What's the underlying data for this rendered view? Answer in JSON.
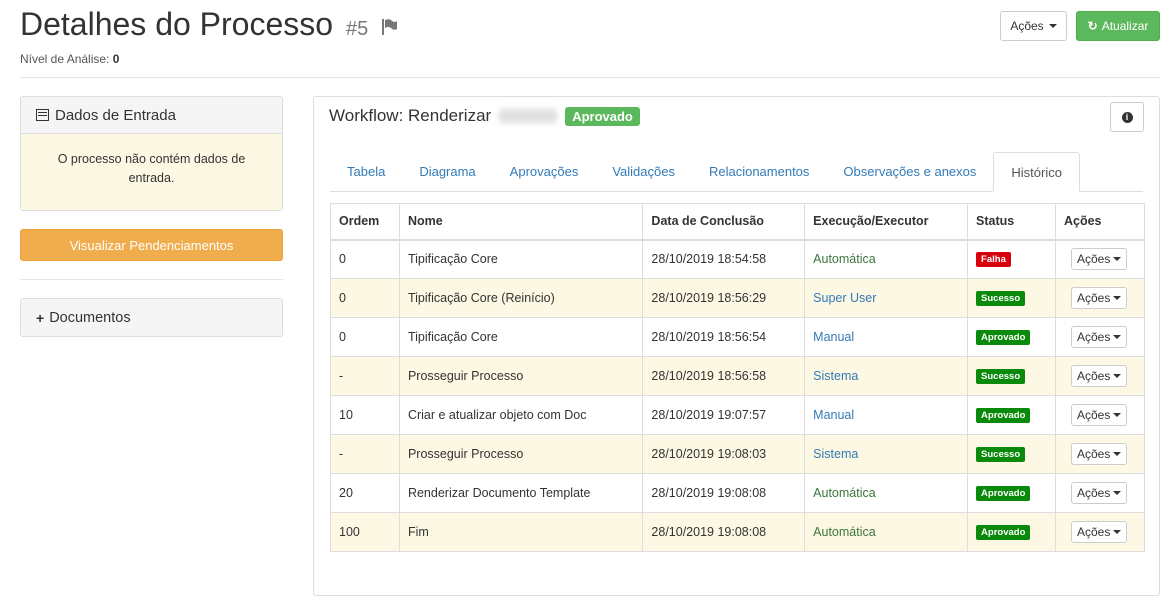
{
  "header": {
    "title": "Detalhes do Processo",
    "process_number": "#5",
    "level_label": "Nível de Análise:",
    "level_value": "0",
    "actions_label": "Ações",
    "refresh_label": "Atualizar"
  },
  "entrada": {
    "title": "Dados de Entrada",
    "message": "O processo não contém dados de entrada."
  },
  "pending_button": "Visualizar Pendenciamentos",
  "documentos": {
    "title": "Documentos"
  },
  "workflow": {
    "title_prefix": "Workflow: Renderizar",
    "status_label": "Aprovado",
    "tabs": [
      {
        "label": "Tabela"
      },
      {
        "label": "Diagrama"
      },
      {
        "label": "Aprovações"
      },
      {
        "label": "Validações"
      },
      {
        "label": "Relacionamentos"
      },
      {
        "label": "Observações e anexos"
      },
      {
        "label": "Histórico"
      }
    ],
    "active_tab": "Histórico",
    "table": {
      "headers": [
        "Ordem",
        "Nome",
        "Data de Conclusão",
        "Execução/Executor",
        "Status",
        "Ações"
      ],
      "action_label": "Ações",
      "rows": [
        {
          "ordem": "0",
          "nome": "Tipificação Core",
          "data": "28/10/2019 18:54:58",
          "exec": "Automática",
          "status": "Falha"
        },
        {
          "ordem": "0",
          "nome": "Tipificação Core (Reinício)",
          "data": "28/10/2019 18:56:29",
          "exec": "Super User",
          "status": "Sucesso"
        },
        {
          "ordem": "0",
          "nome": "Tipificação Core",
          "data": "28/10/2019 18:56:54",
          "exec": "Manual",
          "status": "Aprovado"
        },
        {
          "ordem": "-",
          "nome": "Prosseguir Processo",
          "data": "28/10/2019 18:56:58",
          "exec": "Sistema",
          "status": "Sucesso"
        },
        {
          "ordem": "10",
          "nome": "Criar e atualizar objeto com Doc",
          "data": "28/10/2019 19:07:57",
          "exec": "Manual",
          "status": "Aprovado"
        },
        {
          "ordem": "-",
          "nome": "Prosseguir Processo",
          "data": "28/10/2019 19:08:03",
          "exec": "Sistema",
          "status": "Sucesso"
        },
        {
          "ordem": "20",
          "nome": "Renderizar Documento Template",
          "data": "28/10/2019 19:08:08",
          "exec": "Automática",
          "status": "Aprovado"
        },
        {
          "ordem": "100",
          "nome": "Fim",
          "data": "28/10/2019 19:08:08",
          "exec": "Automática",
          "status": "Aprovado"
        }
      ]
    }
  },
  "colors": {
    "success": "#5cb85c",
    "warning": "#f0ad4e",
    "danger": "#d9000e",
    "link": "#337ab7",
    "automatic": "#3c763d",
    "stripe": "#fcf8e3"
  }
}
